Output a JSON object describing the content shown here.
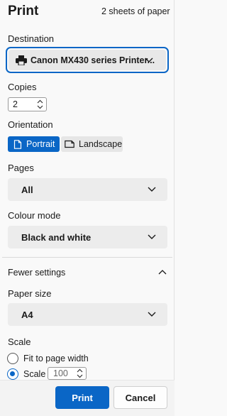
{
  "header": {
    "title": "Print",
    "sheets": "2 sheets of paper"
  },
  "destination": {
    "label": "Destination",
    "value": "Canon MX430 series Printer...",
    "icon": "printer-icon"
  },
  "copies": {
    "label": "Copies",
    "value": "2"
  },
  "orientation": {
    "label": "Orientation",
    "portrait": "Portrait",
    "landscape": "Landscape",
    "selected": "Portrait"
  },
  "pages": {
    "label": "Pages",
    "value": "All"
  },
  "colour_mode": {
    "label": "Colour mode",
    "value": "Black and white"
  },
  "fewer_settings": {
    "label": "Fewer settings"
  },
  "paper_size": {
    "label": "Paper size",
    "value": "A4"
  },
  "scale": {
    "label": "Scale",
    "fit_label": "Fit to page width",
    "scale_label": "Scale",
    "scale_value": "100",
    "selected": "Scale"
  },
  "footer": {
    "print_label": "Print",
    "cancel_label": "Cancel"
  },
  "colors": {
    "accent": "#0a66c6",
    "background": "#f9f9f9",
    "field": "#ececec"
  }
}
